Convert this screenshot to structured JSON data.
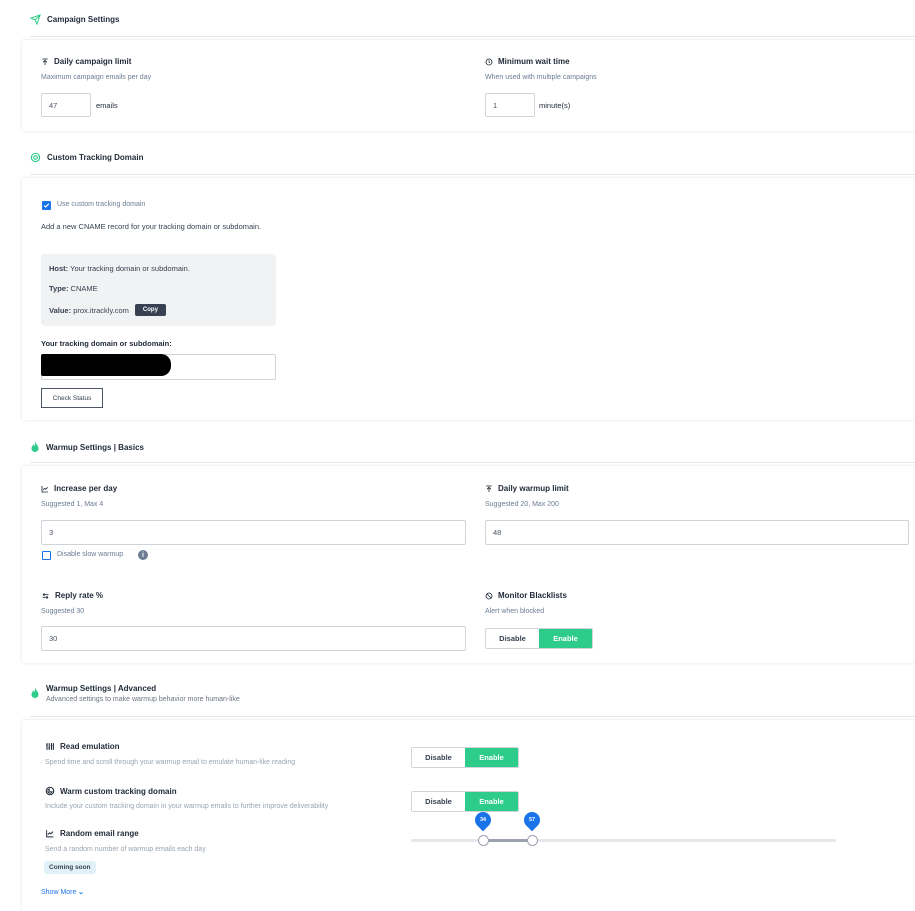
{
  "campaign": {
    "title": "Campaign Settings",
    "daily_limit": {
      "label": "Daily campaign limit",
      "hint": "Maximum campaign emails per day",
      "value": "47",
      "unit": "emails"
    },
    "min_wait": {
      "label": "Minimum wait time",
      "hint": "When used with multiple campaigns",
      "value": "1",
      "unit": "minute(s)"
    }
  },
  "tracking": {
    "title": "Custom Tracking Domain",
    "checkbox_label": "Use custom tracking domain",
    "checked": true,
    "instructions": "Add a new CNAME record for your tracking domain or subdomain.",
    "host_key": "Host:",
    "host_value": "Your tracking domain or subdomain.",
    "type_key": "Type:",
    "type_value": "CNAME",
    "value_key": "Value:",
    "value_value": "prox.itrackly.com",
    "copy_label": "Copy",
    "domain_label": "Your tracking domain or subdomain:",
    "check_status_label": "Check Status"
  },
  "warmup_basics": {
    "title": "Warmup Settings | Basics",
    "increase": {
      "label": "Increase per day",
      "hint": "Suggested 1, Max 4",
      "value": "3"
    },
    "daily_warmup": {
      "label": "Daily warmup limit",
      "hint": "Suggested 20, Max 200",
      "value": "48"
    },
    "slow_warmup_label": "Disable slow warmup",
    "reply_rate": {
      "label": "Reply rate %",
      "hint": "Suggested 30",
      "value": "30"
    },
    "blacklists": {
      "label": "Monitor Blacklists",
      "hint": "Alert when blocked",
      "disable": "Disable",
      "enable": "Enable"
    }
  },
  "warmup_advanced": {
    "title": "Warmup Settings | Advanced",
    "subtitle": "Advanced settings to make warmup behavior more human-like",
    "read_emulation": {
      "label": "Read emulation",
      "hint": "Spend time and scroll through your warmup email to emulate human-like reading",
      "disable": "Disable",
      "enable": "Enable"
    },
    "warm_tracking": {
      "label": "Warm custom tracking domain",
      "hint": "Include your custom tracking domain in your warmup emails to further improve deliverability",
      "disable": "Disable",
      "enable": "Enable"
    },
    "random_range": {
      "label": "Random email range",
      "hint": "Send a random number of warmup emails each day",
      "badge": "Coming soon",
      "min": 34,
      "max": 57,
      "scale_max": 200
    },
    "show_more": "Show More"
  },
  "colors": {
    "accent_green": "#2ecc8a",
    "pin_blue": "#1a73e8"
  }
}
